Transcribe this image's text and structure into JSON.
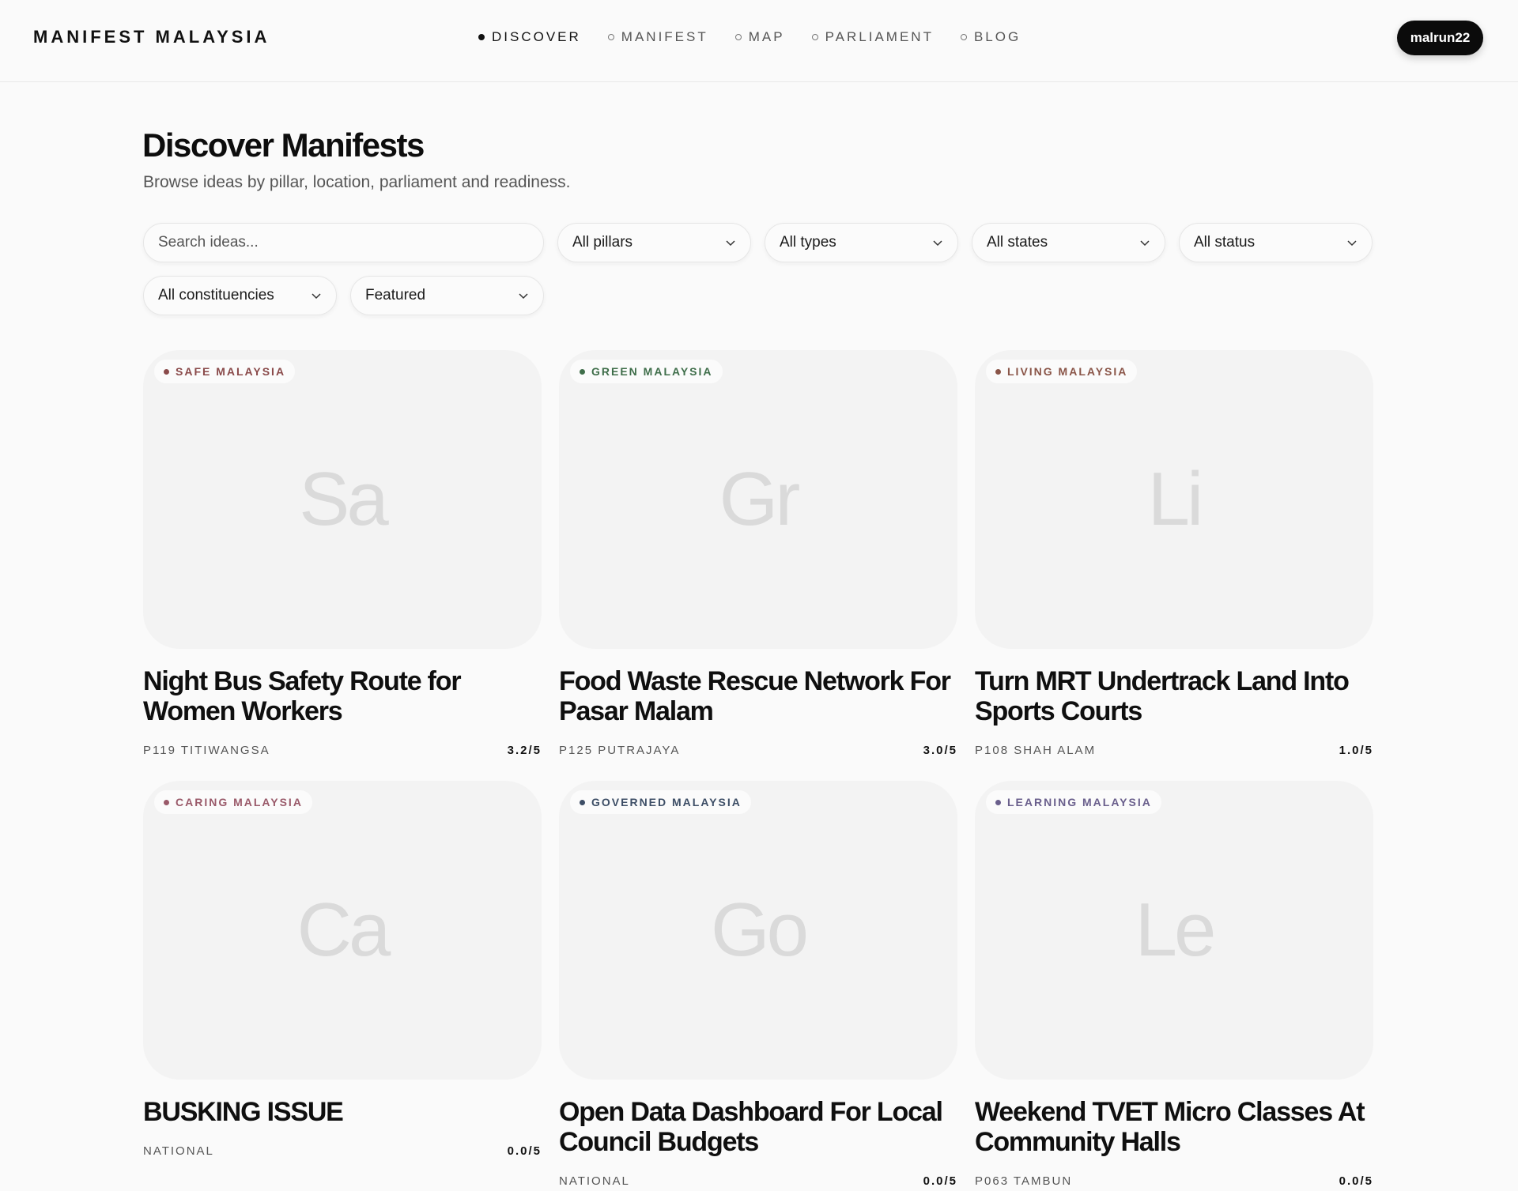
{
  "brand": "MANIFEST MALAYSIA",
  "nav": [
    {
      "label": "DISCOVER",
      "active": true
    },
    {
      "label": "MANIFEST",
      "active": false
    },
    {
      "label": "MAP",
      "active": false
    },
    {
      "label": "PARLIAMENT",
      "active": false
    },
    {
      "label": "BLOG",
      "active": false
    }
  ],
  "user": {
    "label": "malrun22"
  },
  "page": {
    "title": "Discover Manifests",
    "subtitle": "Browse ideas by pillar, location, parliament and readiness."
  },
  "filters": {
    "search_placeholder": "Search ideas...",
    "pillars": "All pillars",
    "types": "All types",
    "states": "All states",
    "status": "All status",
    "constituencies": "All constituencies",
    "sort": "Featured"
  },
  "cards": [
    {
      "pillar": "SAFE MALAYSIA",
      "pillar_color": "#8a4a4a",
      "initials": "Sa",
      "title": "Night Bus Safety Route for Women Workers",
      "location": "P119 TITIWANGSA",
      "rating": "3.2/5"
    },
    {
      "pillar": "GREEN MALAYSIA",
      "pillar_color": "#3f6e4a",
      "initials": "Gr",
      "title": "Food Waste Rescue Network For Pasar Malam",
      "location": "P125 PUTRAJAYA",
      "rating": "3.0/5"
    },
    {
      "pillar": "LIVING MALAYSIA",
      "pillar_color": "#8a5548",
      "initials": "Li",
      "title": "Turn MRT Undertrack Land Into Sports Courts",
      "location": "P108 SHAH ALAM",
      "rating": "1.0/5"
    },
    {
      "pillar": "CARING MALAYSIA",
      "pillar_color": "#9a5a6a",
      "initials": "Ca",
      "title": "BUSKING ISSUE",
      "location": "NATIONAL",
      "rating": "0.0/5"
    },
    {
      "pillar": "GOVERNED MALAYSIA",
      "pillar_color": "#3d4e66",
      "initials": "Go",
      "title": "Open Data Dashboard For Local Council Budgets",
      "location": "NATIONAL",
      "rating": "0.0/5"
    },
    {
      "pillar": "LEARNING MALAYSIA",
      "pillar_color": "#6a5f8c",
      "initials": "Le",
      "title": "Weekend TVET Micro Classes At Community Halls",
      "location": "P063 TAMBUN",
      "rating": "0.0/5"
    }
  ]
}
